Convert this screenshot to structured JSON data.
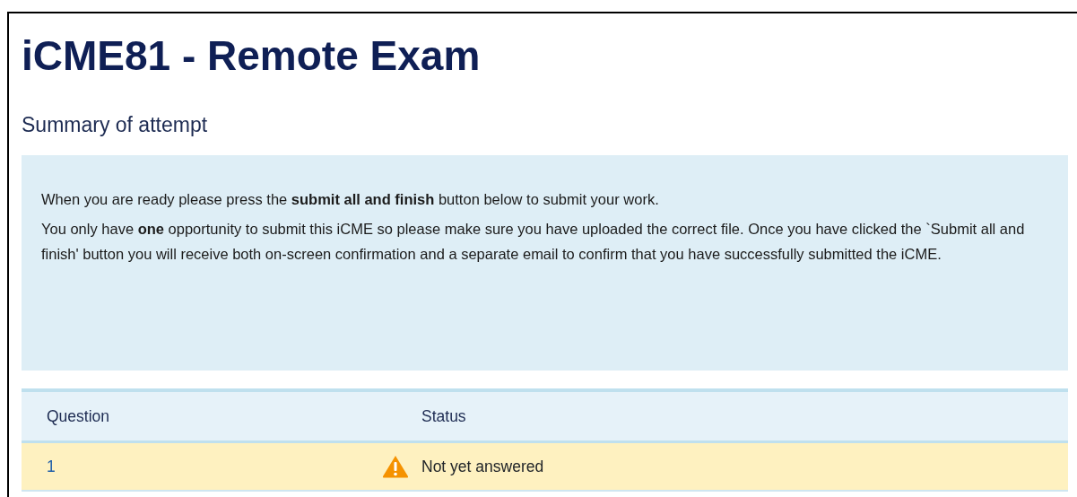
{
  "title": "iCME81 - Remote Exam",
  "subtitle": "Summary of attempt",
  "info": [
    "When you are ready please press the **submit all and finish** button below to submit your work.",
    "You only have **one** opportunity to submit this iCME so please make sure you have uploaded the correct file. Once you have clicked the `Submit all and finish' button you will receive both on-screen confirmation and a separate email to confirm that you have successfully submitted the iCME."
  ],
  "table": {
    "columns": [
      "Question",
      "Status"
    ],
    "rows": [
      {
        "question": "1",
        "status": "Not yet answered",
        "kind": "warning"
      }
    ]
  }
}
